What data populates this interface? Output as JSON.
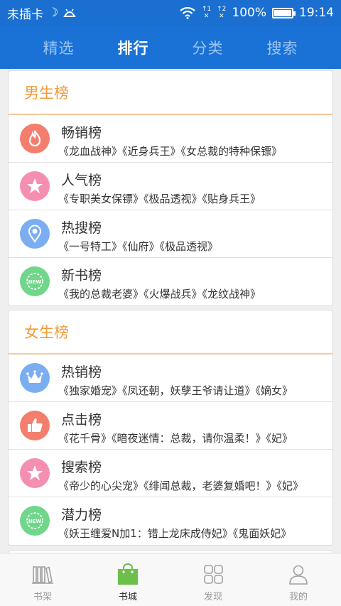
{
  "status": {
    "carrier": "未插卡",
    "sim1": "1",
    "sim2": "2",
    "battery_text": "100%",
    "battery_level": 1.0,
    "time": "19:14"
  },
  "tabs": [
    {
      "label": "精选",
      "active": false
    },
    {
      "label": "排行",
      "active": true
    },
    {
      "label": "分类",
      "active": false
    },
    {
      "label": "搜索",
      "active": false
    }
  ],
  "male": {
    "title": "男生榜",
    "items": [
      {
        "name": "畅销榜",
        "books": "《龙血战神》《近身兵王》《女总裁的特种保镖》",
        "icon": "flame-icon",
        "color": "#f47e6e"
      },
      {
        "name": "人气榜",
        "books": "《专职美女保镖》《极品透视》《贴身兵王》",
        "icon": "star-icon",
        "color": "#f48fb1"
      },
      {
        "name": "热搜榜",
        "books": "《一号特工》《仙府》《极品透视》",
        "icon": "location-pin-icon",
        "color": "#7aaef0"
      },
      {
        "name": "新书榜",
        "books": "《我的总裁老婆》《火爆战兵》《龙纹战神》",
        "icon": "new-badge-icon",
        "color": "#6fd68a"
      }
    ]
  },
  "female": {
    "title": "女生榜",
    "items": [
      {
        "name": "热销榜",
        "books": "《独家婚宠》《凤还朝，妖孽王爷请让道》《嫡女》",
        "icon": "crown-icon",
        "color": "#7aaef0"
      },
      {
        "name": "点击榜",
        "books": "《花千骨》《暗夜迷情：总裁，请你温柔！》《妃》",
        "icon": "thumbs-up-icon",
        "color": "#f47e6e"
      },
      {
        "name": "搜索榜",
        "books": "《帝少的心尖宠》《绯闻总裁，老婆复婚吧！》《妃》",
        "icon": "star-icon",
        "color": "#f48fb1"
      },
      {
        "name": "潜力榜",
        "books": "《妖王缠爱N加1：错上龙床成侍妃》《鬼面妖妃》",
        "icon": "new-badge-icon",
        "color": "#6fd68a"
      }
    ]
  },
  "nav": [
    {
      "label": "书架",
      "icon": "bookshelf-icon",
      "active": false
    },
    {
      "label": "书城",
      "icon": "shopping-bag-icon",
      "active": true
    },
    {
      "label": "发现",
      "icon": "grid-icon",
      "active": false
    },
    {
      "label": "我的",
      "icon": "person-icon",
      "active": false
    }
  ],
  "colors": {
    "primary": "#1a72d6",
    "accent": "#f39a3a",
    "active_nav": "#6cc04a"
  }
}
